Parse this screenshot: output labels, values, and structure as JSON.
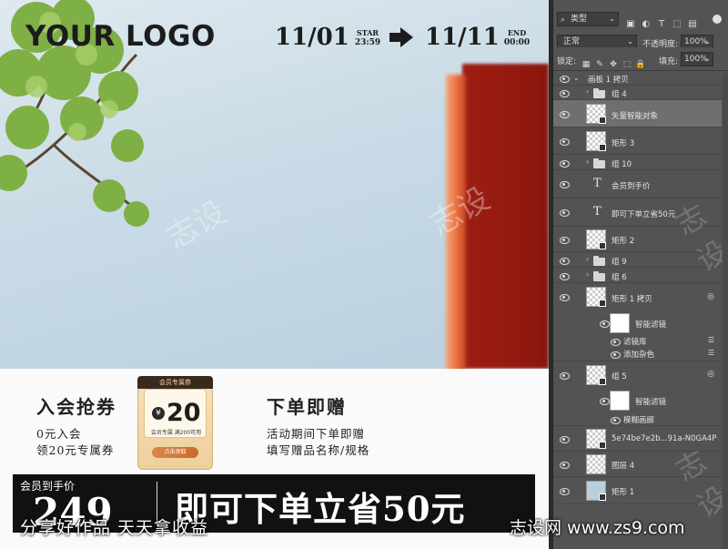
{
  "artboard": {
    "logo": "YOUR LOGO",
    "start_date": "11/01",
    "start_tag": "STAR",
    "start_time": "23:59",
    "end_date": "11/11",
    "end_tag": "END",
    "end_time": "00:00",
    "left_title": "入会抢券",
    "left_line1": "0元入会",
    "left_line2": "领20元专属券",
    "coupon_header": "会员专属券",
    "coupon_yen": "¥",
    "coupon_amount": "20",
    "coupon_desc": "会员专属 满200可用",
    "coupon_button": "点击领取",
    "right_title": "下单即赠",
    "right_line1": "活动期间下单即赠",
    "right_line2": "填写赠品名称/规格",
    "price_label": "会员到手价",
    "price_value": "249",
    "promo_text": "即可下单立省50元",
    "watermark": "志设",
    "accent_building": "#8b160d"
  },
  "footer": {
    "left": "分享好作品 天天拿收益",
    "right": "志设网 www.zs9.com"
  },
  "layers_panel": {
    "kind_filter": "类型",
    "blend_mode": "正常",
    "opacity_label": "不透明度:",
    "opacity_value": "100%",
    "lock_label": "锁定:",
    "fill_label": "填充:",
    "fill_value": "100%",
    "artboard_name": "画板 1 拷贝",
    "layers": [
      {
        "name": "组 4",
        "type": "group"
      },
      {
        "name": "矢量智能对象",
        "type": "smart",
        "selected": true
      },
      {
        "name": "矩形 3",
        "type": "smart"
      },
      {
        "name": "组 10",
        "type": "group"
      },
      {
        "name": "会员到手价",
        "type": "text"
      },
      {
        "name": "即可下单立省50元",
        "type": "text"
      },
      {
        "name": "矩形 2",
        "type": "smart"
      },
      {
        "name": "组 9",
        "type": "group"
      },
      {
        "name": "组 6",
        "type": "group"
      },
      {
        "name": "矩形 1 拷贝",
        "type": "smart"
      },
      {
        "name": "智能滤镜",
        "type": "filter"
      },
      {
        "name": "滤镜库",
        "type": "effect"
      },
      {
        "name": "添加杂色",
        "type": "effect"
      },
      {
        "name": "组 5",
        "type": "smart"
      },
      {
        "name": "智能滤镜",
        "type": "filter"
      },
      {
        "name": "模糊画廊",
        "type": "effect"
      },
      {
        "name": "5e74be7e2b...91a-N0GA4P",
        "type": "smart"
      },
      {
        "name": "图层 4",
        "type": "pixel"
      },
      {
        "name": "矩形 1",
        "type": "smart"
      }
    ]
  }
}
